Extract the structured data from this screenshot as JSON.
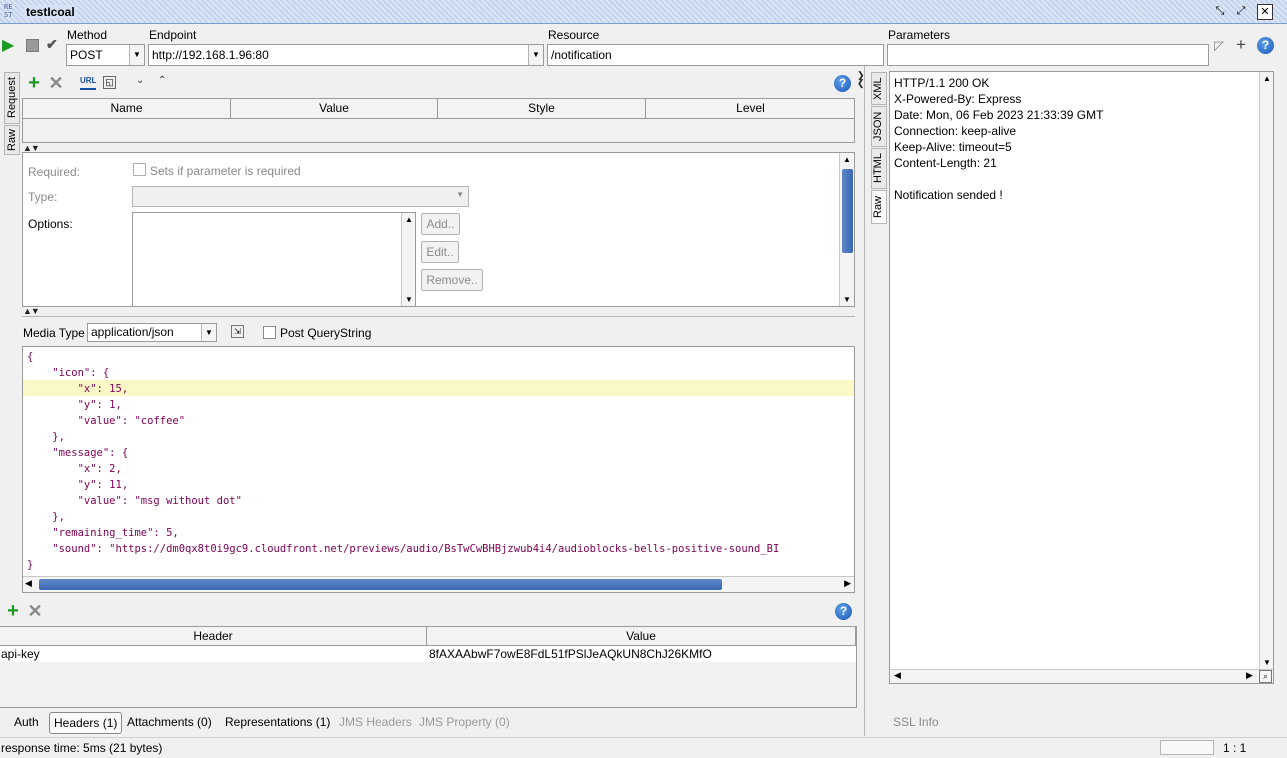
{
  "window": {
    "title": "testIcoal",
    "logo_text": "RE ST"
  },
  "toolbar": {
    "method_label": "Method",
    "method_value": "POST",
    "endpoint_label": "Endpoint",
    "endpoint_value": "http://192.168.1.96:80",
    "resource_label": "Resource",
    "resource_value": "/notification",
    "parameters_label": "Parameters",
    "parameters_value": ""
  },
  "request_tabs": [
    "Request",
    "Raw"
  ],
  "params_table": {
    "columns": [
      "Name",
      "Value",
      "Style",
      "Level"
    ]
  },
  "param_form": {
    "required_label": "Required:",
    "required_checkbox_label": "Sets if parameter is required",
    "type_label": "Type:",
    "options_label": "Options:",
    "add_button": "Add..",
    "edit_button": "Edit..",
    "remove_button": "Remove.."
  },
  "media": {
    "label": "Media Type",
    "value": "application/json",
    "post_querystring_label": "Post QueryString"
  },
  "body_lines": [
    "{",
    "    \"icon\": {",
    "        \"x\": 15,",
    "        \"y\": 1,",
    "        \"value\": \"coffee\"",
    "    },",
    "    \"message\": {",
    "        \"x\": 2,",
    "        \"y\": 11,",
    "        \"value\": \"msg without dot\"",
    "    },",
    "    \"remaining_time\": 5,",
    "    \"sound\": \"https://dm0qx8t0i9gc9.cloudfront.net/previews/audio/BsTwCwBHBjzwub4i4/audioblocks-bells-positive-sound_BI",
    "}"
  ],
  "highlighted_line": 2,
  "headers_table": {
    "columns": [
      "Header",
      "Value"
    ],
    "rows": [
      {
        "header": "api-key",
        "value": "8fAXAAbwF7owE8FdL51fPSlJeAQkUN8ChJ26KMfO"
      }
    ]
  },
  "bottom_tabs": [
    {
      "label": "Auth",
      "state": "normal"
    },
    {
      "label": "Headers (1)",
      "state": "active"
    },
    {
      "label": "Attachments (0)",
      "state": "normal"
    },
    {
      "label": "Representations (1)",
      "state": "normal"
    },
    {
      "label": "JMS Headers",
      "state": "disabled"
    },
    {
      "label": "JMS Property (0)",
      "state": "disabled"
    }
  ],
  "response_tabs": [
    "XML",
    "JSON",
    "HTML",
    "Raw"
  ],
  "response_lines": [
    "HTTP/1.1 200 OK",
    "X-Powered-By: Express",
    "Date: Mon, 06 Feb 2023 21:33:39 GMT",
    "Connection: keep-alive",
    "Keep-Alive: timeout=5",
    "Content-Length: 21",
    "",
    "Notification sended !"
  ],
  "response_footer": {
    "ssl_info": "SSL Info"
  },
  "status": {
    "text": "response time: 5ms (21 bytes)",
    "cursor": "1 : 1"
  }
}
